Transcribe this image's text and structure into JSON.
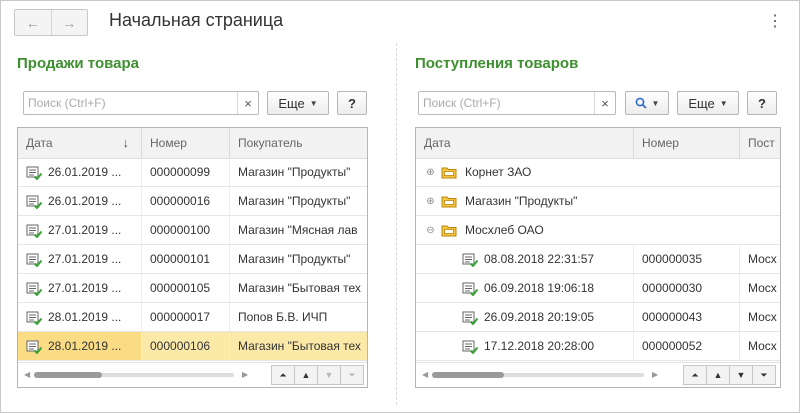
{
  "window": {
    "title": "Начальная страница",
    "back_icon": "←",
    "forward_icon": "→",
    "more_icon": "⋮"
  },
  "left_panel": {
    "title": "Продажи товара",
    "search_placeholder": "Поиск (Ctrl+F)",
    "clear_icon": "×",
    "more_label": "Еще",
    "help_label": "?",
    "columns": [
      "Дата",
      "Номер",
      "Покупатель"
    ],
    "sort_indicator": "↓",
    "rows": [
      {
        "date": "26.01.2019 ...",
        "number": "000000099",
        "customer": "Магазин \"Продукты\""
      },
      {
        "date": "26.01.2019 ...",
        "number": "000000016",
        "customer": "Магазин \"Продукты\""
      },
      {
        "date": "27.01.2019 ...",
        "number": "000000100",
        "customer": "Магазин \"Мясная лав"
      },
      {
        "date": "27.01.2019 ...",
        "number": "000000101",
        "customer": "Магазин \"Продукты\""
      },
      {
        "date": "27.01.2019 ...",
        "number": "000000105",
        "customer": "Магазин \"Бытовая тех"
      },
      {
        "date": "28.01.2019 ...",
        "number": "000000017",
        "customer": "Попов Б.В. ИЧП"
      },
      {
        "date": "28.01.2019 ...",
        "number": "000000106",
        "customer": "Магазин \"Бытовая тех",
        "selected": true
      }
    ],
    "scroll_fraction": 0.34
  },
  "right_panel": {
    "title": "Поступления товаров",
    "search_placeholder": "Поиск (Ctrl+F)",
    "clear_icon": "×",
    "search_button_icon": "search-icon",
    "more_label": "Еще",
    "help_label": "?",
    "columns": [
      "Дата",
      "Номер",
      "Пост"
    ],
    "groups": [
      {
        "name": "Корнет ЗАО",
        "expander": "⊕"
      },
      {
        "name": "Магазин \"Продукты\"",
        "expander": "⊕"
      },
      {
        "name": "Мосхлеб ОАО",
        "expander": "⊖"
      }
    ],
    "rows": [
      {
        "date": "08.08.2018 22:31:57",
        "number": "000000035",
        "supplier": "Мосх"
      },
      {
        "date": "06.09.2018 19:06:18",
        "number": "000000030",
        "supplier": "Мосх"
      },
      {
        "date": "26.09.2018 20:19:05",
        "number": "000000043",
        "supplier": "Мосх"
      },
      {
        "date": "17.12.2018 20:28:00",
        "number": "000000052",
        "supplier": "Мосх"
      }
    ],
    "scroll_fraction": 0.34
  },
  "colors": {
    "panel_title": "#3d8f2f",
    "selected_row": "#fbe9a8",
    "doc_icon_green": "#3aa537"
  }
}
